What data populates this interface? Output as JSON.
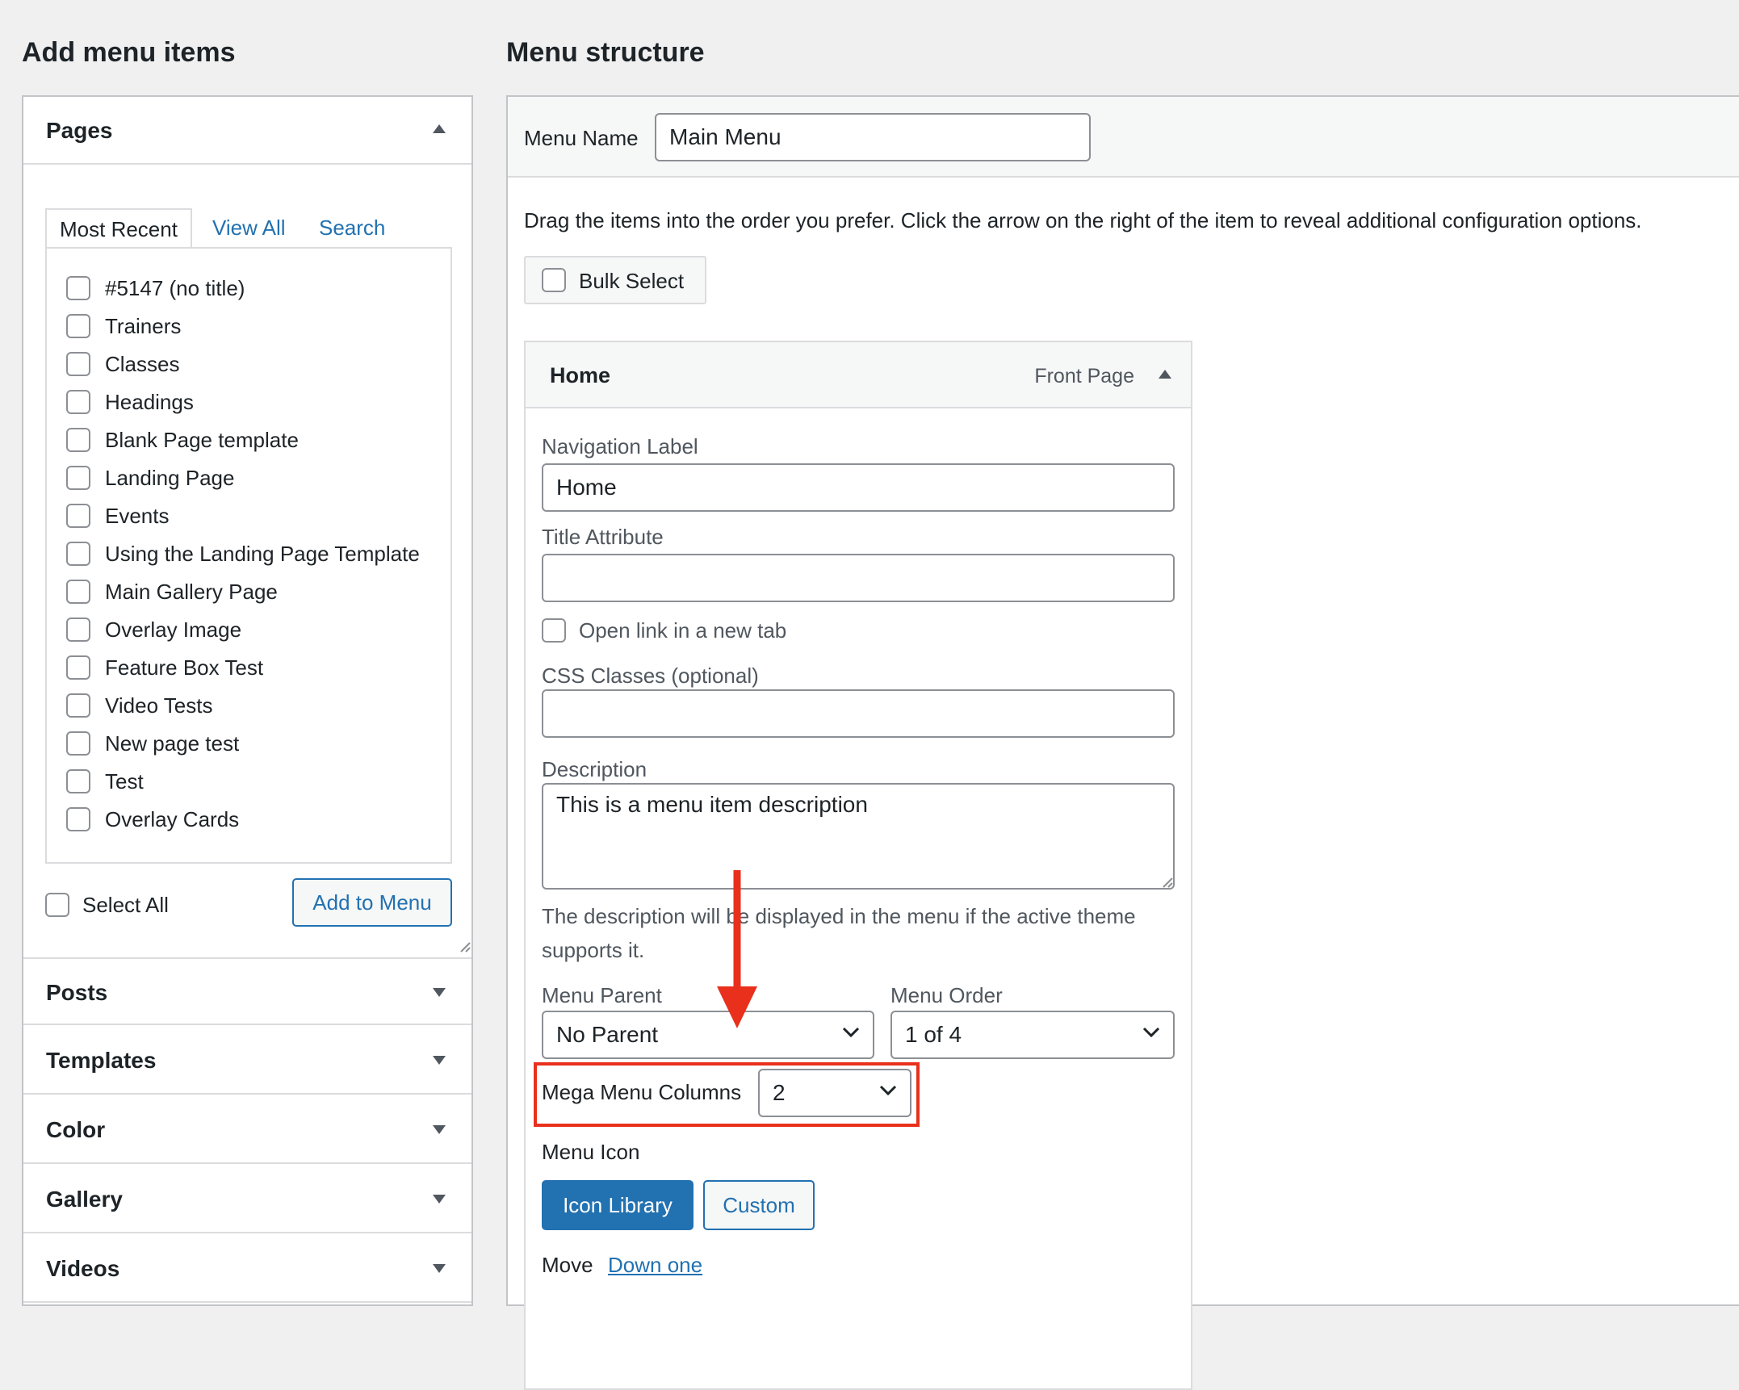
{
  "left": {
    "heading": "Add menu items",
    "pages": {
      "title": "Pages",
      "tabs": [
        "Most Recent",
        "View All",
        "Search"
      ],
      "items": [
        "#5147 (no title)",
        "Trainers",
        "Classes",
        "Headings",
        "Blank Page template",
        "Landing Page",
        "Events",
        "Using the Landing Page Template",
        "Main Gallery Page",
        "Overlay Image",
        "Feature Box Test",
        "Video Tests",
        "New page test",
        "Test",
        "Overlay Cards"
      ],
      "select_all": "Select All",
      "add_button": "Add to Menu"
    },
    "sections": [
      "Posts",
      "Templates",
      "Color",
      "Gallery",
      "Videos"
    ]
  },
  "right": {
    "heading": "Menu structure",
    "menu_name_label": "Menu Name",
    "menu_name_value": "Main Menu",
    "instructions": "Drag the items into the order you prefer. Click the arrow on the right of the item to reveal additional configuration options.",
    "bulk_select": "Bulk Select",
    "item": {
      "title": "Home",
      "type": "Front Page",
      "nav_label_label": "Navigation Label",
      "nav_label_value": "Home",
      "title_attr_label": "Title Attribute",
      "title_attr_value": "",
      "new_tab_label": "Open link in a new tab",
      "css_label": "CSS Classes (optional)",
      "css_value": "",
      "desc_label": "Description",
      "desc_value": "This is a menu item description",
      "desc_help_line1": "The description will be displayed in the menu if the active theme",
      "desc_help_line2": "supports it.",
      "parent_label": "Menu Parent",
      "parent_value": "No Parent",
      "order_label": "Menu Order",
      "order_value": "1 of 4",
      "mega_label": "Mega Menu Columns",
      "mega_value": "2",
      "icon_label": "Menu Icon",
      "icon_library": "Icon Library",
      "icon_custom": "Custom",
      "move_label": "Move",
      "move_link": "Down one"
    }
  },
  "annotation": {
    "color": "#e8301c"
  }
}
